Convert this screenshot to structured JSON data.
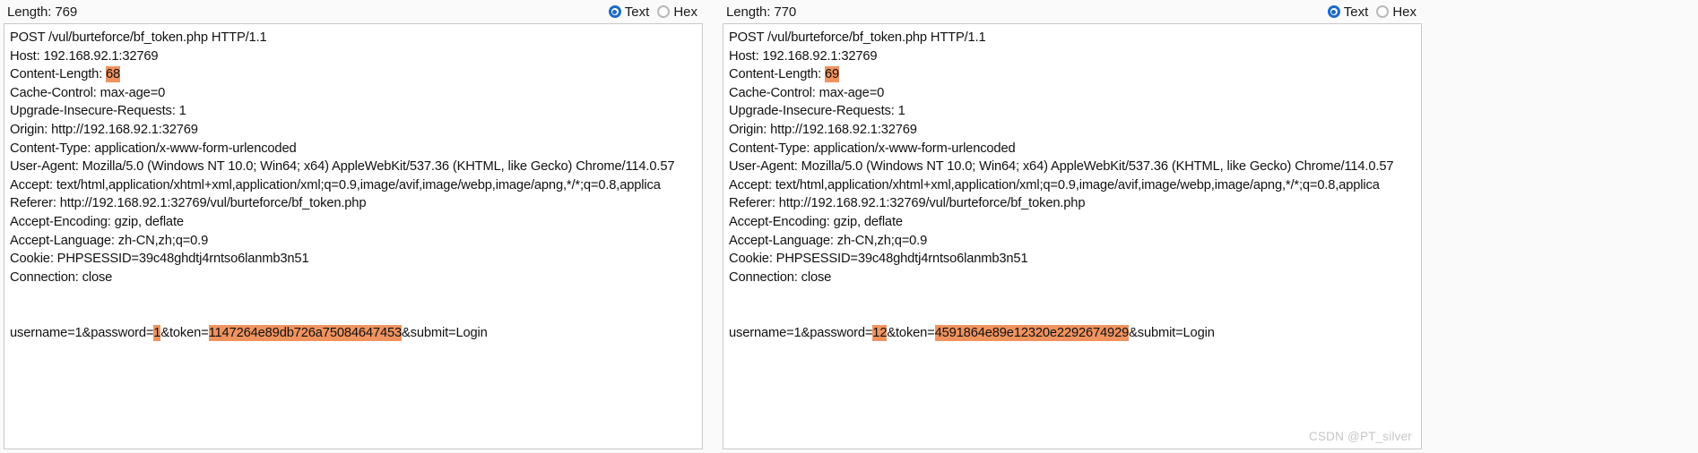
{
  "window": {
    "background": "#fafafa",
    "highlight_color": "#f0935f",
    "radio_accent": "#1b6ac9"
  },
  "panels": [
    {
      "id": "left-request",
      "length_label": "Length: 769",
      "view_modes": [
        {
          "label": "Text",
          "selected": true
        },
        {
          "label": "Hex",
          "selected": false
        }
      ],
      "lines": [
        {
          "segments": [
            {
              "text": "POST /vul/burteforce/bf_token.php HTTP/1.1",
              "highlight": false
            }
          ]
        },
        {
          "segments": [
            {
              "text": "Host: 192.168.92.1:32769",
              "highlight": false
            }
          ]
        },
        {
          "segments": [
            {
              "text": "Content-Length: ",
              "highlight": false
            },
            {
              "text": "68",
              "highlight": true
            }
          ]
        },
        {
          "segments": [
            {
              "text": "Cache-Control: max-age=0",
              "highlight": false
            }
          ]
        },
        {
          "segments": [
            {
              "text": "Upgrade-Insecure-Requests: 1",
              "highlight": false
            }
          ]
        },
        {
          "segments": [
            {
              "text": "Origin: http://192.168.92.1:32769",
              "highlight": false
            }
          ]
        },
        {
          "segments": [
            {
              "text": "Content-Type: application/x-www-form-urlencoded",
              "highlight": false
            }
          ]
        },
        {
          "segments": [
            {
              "text": "User-Agent: Mozilla/5.0 (Windows NT 10.0; Win64; x64) AppleWebKit/537.36 (KHTML, like Gecko) Chrome/114.0.57",
              "highlight": false
            }
          ]
        },
        {
          "segments": [
            {
              "text": "Accept: text/html,application/xhtml+xml,application/xml;q=0.9,image/avif,image/webp,image/apng,*/*;q=0.8,applica",
              "highlight": false
            }
          ]
        },
        {
          "segments": [
            {
              "text": "Referer: http://192.168.92.1:32769/vul/burteforce/bf_token.php",
              "highlight": false
            }
          ]
        },
        {
          "segments": [
            {
              "text": "Accept-Encoding: gzip, deflate",
              "highlight": false
            }
          ]
        },
        {
          "segments": [
            {
              "text": "Accept-Language: zh-CN,zh;q=0.9",
              "highlight": false
            }
          ]
        },
        {
          "segments": [
            {
              "text": "Cookie: PHPSESSID=39c48ghdtj4rntso6lanmb3n51",
              "highlight": false
            }
          ]
        },
        {
          "segments": [
            {
              "text": "Connection: close",
              "highlight": false
            }
          ]
        },
        {
          "segments": [
            {
              "text": "",
              "highlight": false
            }
          ]
        },
        {
          "segments": [
            {
              "text": "",
              "highlight": false
            }
          ]
        },
        {
          "segments": [
            {
              "text": "username=1&password=",
              "highlight": false
            },
            {
              "text": "1",
              "highlight": true
            },
            {
              "text": "&token=",
              "highlight": false
            },
            {
              "text": "1147264e89db726a75084647453",
              "highlight": true
            },
            {
              "text": "&submit=Login",
              "highlight": false
            }
          ]
        }
      ],
      "watermark": ""
    },
    {
      "id": "right-request",
      "length_label": "Length: 770",
      "view_modes": [
        {
          "label": "Text",
          "selected": true
        },
        {
          "label": "Hex",
          "selected": false
        }
      ],
      "lines": [
        {
          "segments": [
            {
              "text": "POST /vul/burteforce/bf_token.php HTTP/1.1",
              "highlight": false
            }
          ]
        },
        {
          "segments": [
            {
              "text": "Host: 192.168.92.1:32769",
              "highlight": false
            }
          ]
        },
        {
          "segments": [
            {
              "text": "Content-Length: ",
              "highlight": false
            },
            {
              "text": "69",
              "highlight": true
            }
          ]
        },
        {
          "segments": [
            {
              "text": "Cache-Control: max-age=0",
              "highlight": false
            }
          ]
        },
        {
          "segments": [
            {
              "text": "Upgrade-Insecure-Requests: 1",
              "highlight": false
            }
          ]
        },
        {
          "segments": [
            {
              "text": "Origin: http://192.168.92.1:32769",
              "highlight": false
            }
          ]
        },
        {
          "segments": [
            {
              "text": "Content-Type: application/x-www-form-urlencoded",
              "highlight": false
            }
          ]
        },
        {
          "segments": [
            {
              "text": "User-Agent: Mozilla/5.0 (Windows NT 10.0; Win64; x64) AppleWebKit/537.36 (KHTML, like Gecko) Chrome/114.0.57",
              "highlight": false
            }
          ]
        },
        {
          "segments": [
            {
              "text": "Accept: text/html,application/xhtml+xml,application/xml;q=0.9,image/avif,image/webp,image/apng,*/*;q=0.8,applica",
              "highlight": false
            }
          ]
        },
        {
          "segments": [
            {
              "text": "Referer: http://192.168.92.1:32769/vul/burteforce/bf_token.php",
              "highlight": false
            }
          ]
        },
        {
          "segments": [
            {
              "text": "Accept-Encoding: gzip, deflate",
              "highlight": false
            }
          ]
        },
        {
          "segments": [
            {
              "text": "Accept-Language: zh-CN,zh;q=0.9",
              "highlight": false
            }
          ]
        },
        {
          "segments": [
            {
              "text": "Cookie: PHPSESSID=39c48ghdtj4rntso6lanmb3n51",
              "highlight": false
            }
          ]
        },
        {
          "segments": [
            {
              "text": "Connection: close",
              "highlight": false
            }
          ]
        },
        {
          "segments": [
            {
              "text": "",
              "highlight": false
            }
          ]
        },
        {
          "segments": [
            {
              "text": "",
              "highlight": false
            }
          ]
        },
        {
          "segments": [
            {
              "text": "username=1&password=",
              "highlight": false
            },
            {
              "text": "12",
              "highlight": true
            },
            {
              "text": "&token=",
              "highlight": false
            },
            {
              "text": "4591864e89e12320e2292674929",
              "highlight": true
            },
            {
              "text": "&submit=Login",
              "highlight": false
            }
          ]
        }
      ],
      "watermark": "CSDN @PT_silver"
    }
  ]
}
